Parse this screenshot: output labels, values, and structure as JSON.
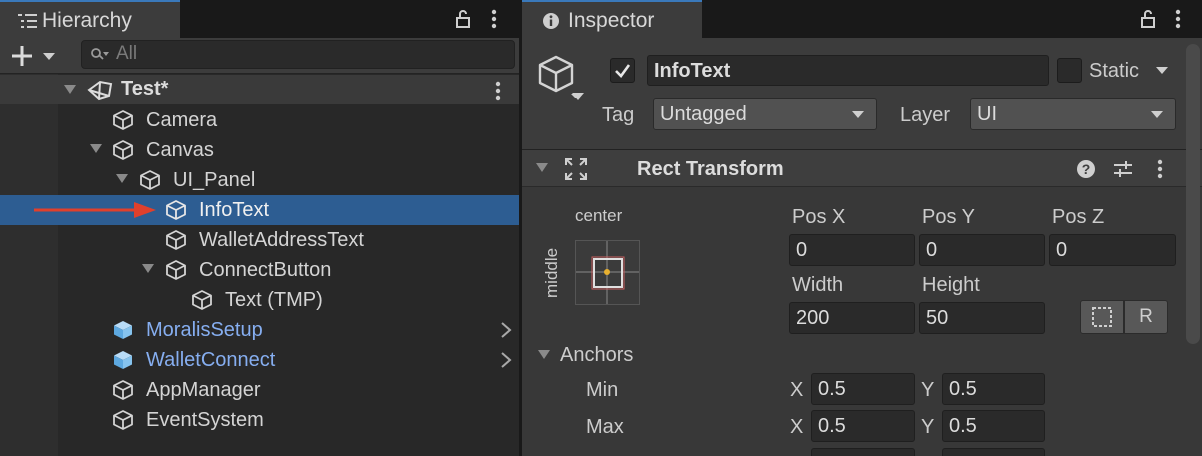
{
  "hierarchy": {
    "tab_label": "Hierarchy",
    "search_placeholder": "All",
    "scene_name": "Test*",
    "items": [
      {
        "label": "Camera"
      },
      {
        "label": "Canvas"
      },
      {
        "label": "UI_Panel"
      },
      {
        "label": "InfoText",
        "selected": true
      },
      {
        "label": "WalletAddressText"
      },
      {
        "label": "ConnectButton"
      },
      {
        "label": "Text (TMP)"
      },
      {
        "label": "MoralisSetup",
        "prefab": true
      },
      {
        "label": "WalletConnect",
        "prefab": true
      },
      {
        "label": "AppManager"
      },
      {
        "label": "EventSystem"
      }
    ]
  },
  "inspector": {
    "tab_label": "Inspector",
    "object_name": "InfoText",
    "static_label": "Static",
    "tag_label": "Tag",
    "tag_value": "Untagged",
    "layer_label": "Layer",
    "layer_value": "UI",
    "rect_transform": {
      "title": "Rect Transform",
      "anchor_h": "center",
      "anchor_v": "middle",
      "pos_x_label": "Pos X",
      "pos_y_label": "Pos Y",
      "pos_z_label": "Pos Z",
      "pos_x": "0",
      "pos_y": "0",
      "pos_z": "0",
      "width_label": "Width",
      "height_label": "Height",
      "width": "200",
      "height": "50",
      "r_button": "R",
      "anchors_label": "Anchors",
      "min_label": "Min",
      "max_label": "Max",
      "x_label": "X",
      "y_label": "Y",
      "min_x": "0.5",
      "min_y": "0.5",
      "max_x": "0.5",
      "max_y": "0.5"
    }
  },
  "colors": {
    "selection": "#2d5d92",
    "prefab_text": "#86aef0",
    "annotation_arrow": "#e0402c",
    "tab_accent": "#3a79bb"
  }
}
